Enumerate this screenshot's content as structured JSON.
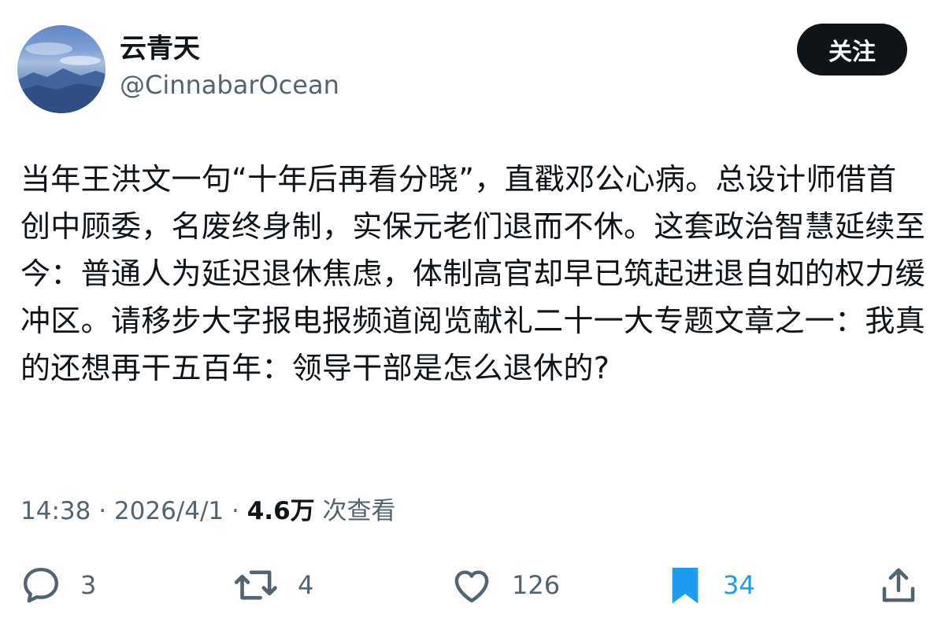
{
  "user": {
    "display_name": "云青天",
    "handle": "@CinnabarOcean"
  },
  "follow_button": {
    "label": "关注"
  },
  "post": {
    "text": "当年王洪文一句“十年后再看分晓”，直戳邓公心病。总设计师借首创中顾委，名废终身制，实保元老们退而不休。这套政治智慧延续至今：普通人为延迟退休焦虑，体制高官却早已筑起进退自如的权力缓冲区。请移步大字报电报频道阅览献礼二十一大专题文章之一：我真的还想再干五百年：领导干部是怎么退休的?"
  },
  "meta": {
    "time": "14:38",
    "date": "2026/4/1",
    "views": "4.6万",
    "views_suffix": "次查看",
    "separator": "·"
  },
  "actions": {
    "reply_count": "3",
    "repost_count": "4",
    "like_count": "126",
    "bookmark_count": "34"
  },
  "colors": {
    "text": "#0f1419",
    "secondary": "#536471",
    "accent": "#1d9bf0",
    "button_bg": "#0f1419"
  },
  "icons": [
    "reply-icon",
    "repost-icon",
    "like-icon",
    "bookmark-icon",
    "share-icon"
  ]
}
